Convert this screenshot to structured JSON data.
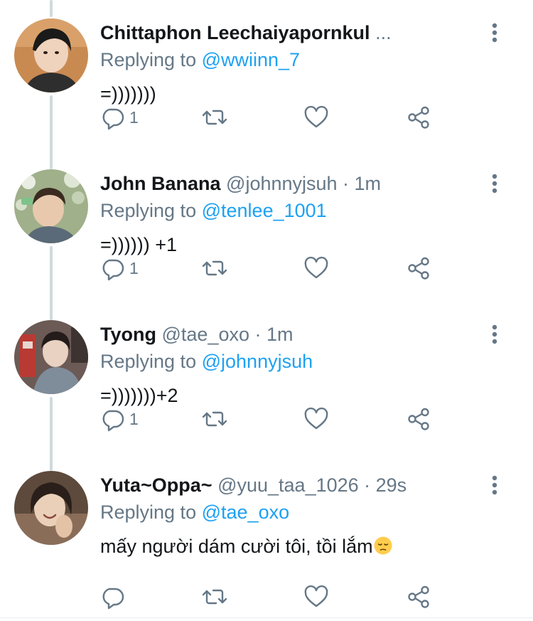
{
  "tweets": [
    {
      "display_name": "Chittaphon Leechaiyapornkul",
      "meta": "...",
      "replying_prefix": "Replying to",
      "replying_handle": "@wwiinn_7",
      "text": "=)))))))",
      "reply_count": "1"
    },
    {
      "display_name": "John Banana",
      "meta": "@johnnyjsuh · 1m",
      "replying_prefix": "Replying to",
      "replying_handle": "@tenlee_1001",
      "text": "=)))))) +1",
      "reply_count": "1"
    },
    {
      "display_name": "Tyong",
      "meta": "@tae_oxo · 1m",
      "replying_prefix": "Replying to",
      "replying_handle": "@johnnyjsuh",
      "text": "=)))))))+2",
      "reply_count": "1"
    },
    {
      "display_name": "Yuta~Oppa~",
      "meta": "@yuu_taa_1026 · 29s",
      "replying_prefix": "Replying to",
      "replying_handle": "@tae_oxo",
      "text": "mấy người dám cười tôi, tồi lắm",
      "reply_count": ""
    }
  ],
  "icons": {
    "reply": "reply-icon",
    "retweet": "retweet-icon",
    "like": "heart-icon",
    "share": "share-icon",
    "more": "more-vertical-icon",
    "emoji": "pensive-face-emoji"
  },
  "colors": {
    "link": "#1da1f2",
    "secondary": "#657786",
    "primary": "#14171a",
    "thread_line": "#cfd9de"
  }
}
